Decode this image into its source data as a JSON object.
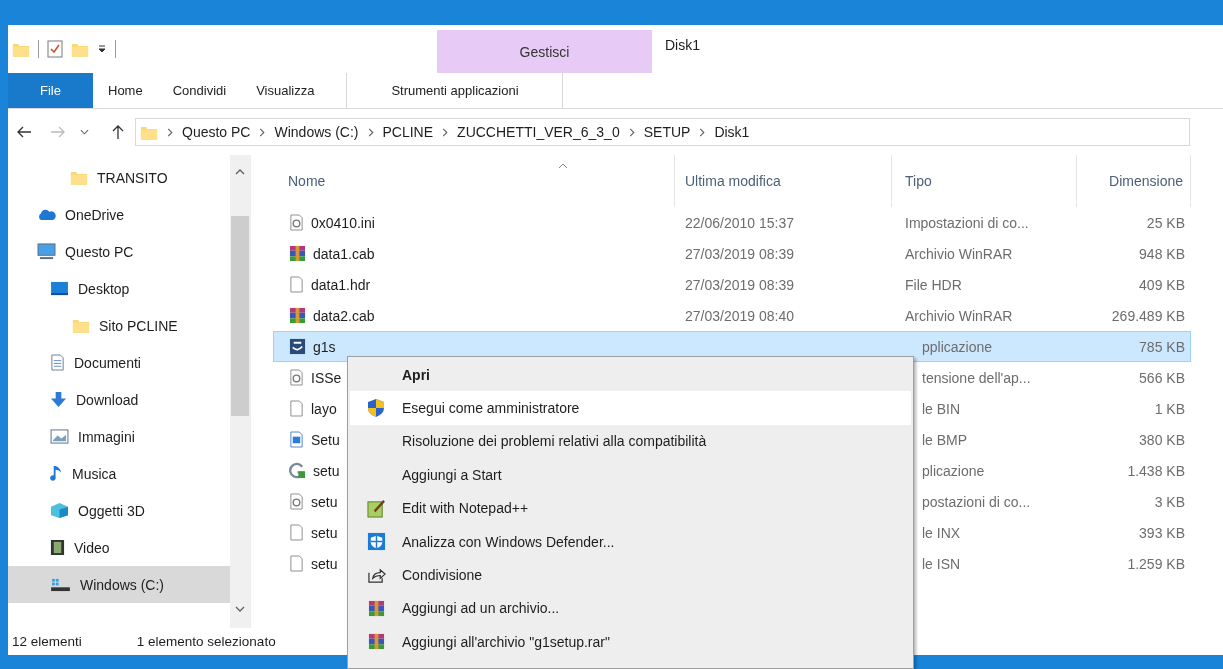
{
  "window": {
    "title": "Disk1"
  },
  "ribbon": {
    "context_group": "Gestisci",
    "tabs": [
      {
        "label": "File",
        "selected": false,
        "kind": "file"
      },
      {
        "label": "Home",
        "selected": false,
        "kind": "tab"
      },
      {
        "label": "Condividi",
        "selected": false,
        "kind": "tab"
      },
      {
        "label": "Visualizza",
        "selected": false,
        "kind": "tab"
      },
      {
        "label": "Strumenti applicazioni",
        "selected": false,
        "kind": "context"
      }
    ]
  },
  "address_bar": {
    "breadcrumbs": [
      "Questo PC",
      "Windows (C:)",
      "PCLINE",
      "ZUCCHETTI_VER_6_3_0",
      "SETUP",
      "Disk1"
    ]
  },
  "sidebar": {
    "items": [
      {
        "label": "TRANSITO",
        "kind": "folder",
        "selected": false
      },
      {
        "label": "OneDrive",
        "kind": "cloud",
        "selected": false
      },
      {
        "label": "Questo PC",
        "kind": "pc",
        "selected": false,
        "children": [
          {
            "label": "Desktop",
            "kind": "desktop",
            "selected": false,
            "children": [
              {
                "label": "Sito PCLINE",
                "kind": "folder",
                "selected": false
              }
            ]
          },
          {
            "label": "Documenti",
            "kind": "document",
            "selected": false
          },
          {
            "label": "Download",
            "kind": "download",
            "selected": false
          },
          {
            "label": "Immagini",
            "kind": "image",
            "selected": false
          },
          {
            "label": "Musica",
            "kind": "music",
            "selected": false
          },
          {
            "label": "Oggetti 3D",
            "kind": "cube",
            "selected": false
          },
          {
            "label": "Video",
            "kind": "film",
            "selected": false
          },
          {
            "label": "Windows (C:)",
            "kind": "drive",
            "selected": true
          }
        ]
      }
    ]
  },
  "table": {
    "columns": [
      "Nome",
      "Ultima modifica",
      "Tipo",
      "Dimensione"
    ],
    "rows": [
      {
        "kind": "settings",
        "name": "0x0410.ini",
        "modified": "22/06/2010 15:37",
        "type": "Impostazioni di co...",
        "size": "25 KB",
        "selected": false
      },
      {
        "kind": "archive",
        "name": "data1.cab",
        "modified": "27/03/2019 08:39",
        "type": "Archivio WinRAR",
        "size": "948 KB",
        "selected": false
      },
      {
        "kind": "blank",
        "name": "data1.hdr",
        "modified": "27/03/2019 08:39",
        "type": "File HDR",
        "size": "409 KB",
        "selected": false
      },
      {
        "kind": "archive",
        "name": "data2.cab",
        "modified": "27/03/2019 08:40",
        "type": "Archivio WinRAR",
        "size": "269.489 KB",
        "selected": false
      },
      {
        "kind": "app",
        "name": "g1s",
        "type": "pplicazione",
        "size": "785 KB",
        "selected": true
      },
      {
        "kind": "settings",
        "name": "ISSe",
        "type": "tensione dell'ap...",
        "size": "566 KB",
        "selected": false
      },
      {
        "kind": "blank",
        "name": "layo",
        "type": "le BIN",
        "size": "1 KB",
        "selected": false
      },
      {
        "kind": "bitmap",
        "name": "Setu",
        "type": "le BMP",
        "size": "380 KB",
        "selected": false
      },
      {
        "kind": "setup",
        "name": "setu",
        "type": "plicazione",
        "size": "1.438 KB",
        "selected": false
      },
      {
        "kind": "settings",
        "name": "setu",
        "type": "postazioni di co...",
        "size": "3 KB",
        "selected": false
      },
      {
        "kind": "blank",
        "name": "setu",
        "type": "le INX",
        "size": "393 KB",
        "selected": false
      },
      {
        "kind": "blank",
        "name": "setu",
        "type": "le ISN",
        "size": "1.259 KB",
        "selected": false
      }
    ]
  },
  "status_bar": {
    "count": "12 elementi",
    "selection": "1 elemento selezionato"
  },
  "context_menu": {
    "items": [
      {
        "label": "Apri",
        "kind": "none",
        "default": true,
        "selected": false
      },
      {
        "label": "Esegui come amministratore",
        "kind": "shield",
        "default": false,
        "selected": true
      },
      {
        "label": "Risoluzione dei problemi relativi alla compatibilità",
        "kind": "none",
        "default": false,
        "selected": false
      },
      {
        "label": "Aggiungi a Start",
        "kind": "none",
        "default": false,
        "selected": false
      },
      {
        "label": "Edit with Notepad++",
        "kind": "notepad",
        "default": false,
        "selected": false
      },
      {
        "label": "Analizza con Windows Defender...",
        "kind": "defender",
        "default": false,
        "selected": false
      },
      {
        "label": "Condivisione",
        "kind": "share",
        "default": false,
        "selected": false
      },
      {
        "label": "Aggiungi ad un archivio...",
        "kind": "archive",
        "default": false,
        "selected": false
      },
      {
        "label": "Aggiungi all'archivio \"g1setup.rar\"",
        "kind": "archive",
        "default": false,
        "selected": false
      }
    ]
  }
}
